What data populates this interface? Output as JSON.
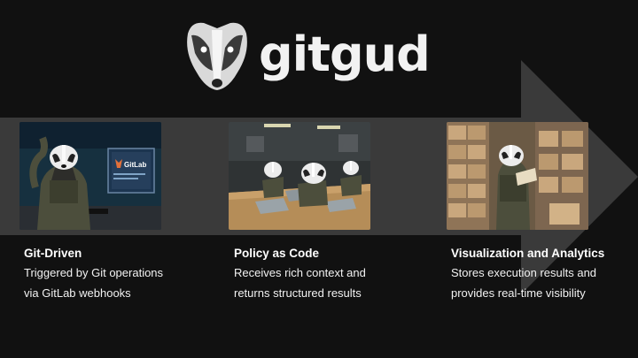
{
  "brand": {
    "name": "gitgud",
    "logo_icon": "badger-icon"
  },
  "colors": {
    "background": "#111111",
    "arrow": "#3a3a3a",
    "text": "#ffffff"
  },
  "cards": [
    {
      "title": "Git-Driven",
      "lines": [
        "Triggered by Git operations",
        "via GitLab webhooks"
      ],
      "screen_text": "GitLab",
      "image": "badger-soldier-at-computer"
    },
    {
      "title": "Policy as Code",
      "lines": [
        "Receives rich context and",
        "returns structured results"
      ],
      "image": "badgers-working-on-laptops"
    },
    {
      "title": "Visualization and Analytics",
      "lines": [
        "Stores execution results and",
        "provides real-time visibility"
      ],
      "image": "badger-reading-in-archive"
    }
  ]
}
